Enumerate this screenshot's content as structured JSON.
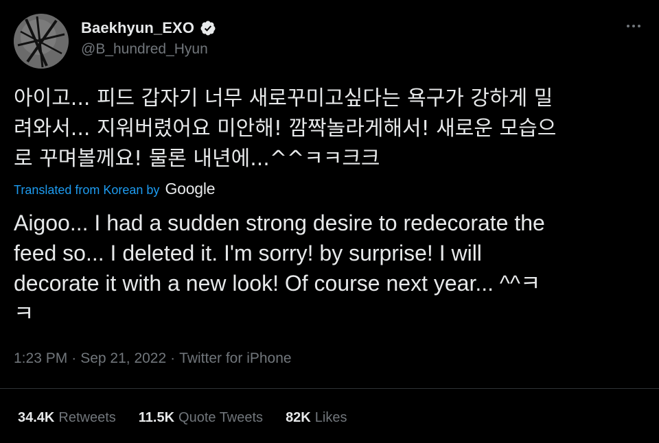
{
  "author": {
    "display_name": "Baekhyun_EXO",
    "handle": "@B_hundred_Hyun",
    "verified": true,
    "avatar_icon": "avatar-image"
  },
  "tweet": {
    "original_text": "아이고... 피드 갑자기 너무 새로꾸미고싶다는 욕구가 강하게 밀\n려와서... 지워버렸어요 미안해! 깜짝놀라게해서! 새로운 모습으\n로 꾸며볼께요! 물론 내년에...^^ㅋㅋ크크",
    "translated_label": "Translated from Korean by",
    "translator": "Google",
    "translated_text": "Aigoo... I had a sudden strong desire to redecorate the\nfeed so... I deleted it. I'm sorry! by surprise! I will\ndecorate it with a new look! Of course next year... ^^ㅋ\nㅋ",
    "time": "1:23 PM",
    "date": "Sep 21, 2022",
    "source": "Twitter for iPhone",
    "separator": "·"
  },
  "stats": {
    "retweets_count": "34.4K",
    "retweets_label": "Retweets",
    "quotes_count": "11.5K",
    "quotes_label": "Quote Tweets",
    "likes_count": "82K",
    "likes_label": "Likes"
  },
  "colors": {
    "background": "#000000",
    "text": "#e7e9ea",
    "secondary": "#71767b",
    "link": "#1d9bf0",
    "divider": "#2f3336"
  }
}
